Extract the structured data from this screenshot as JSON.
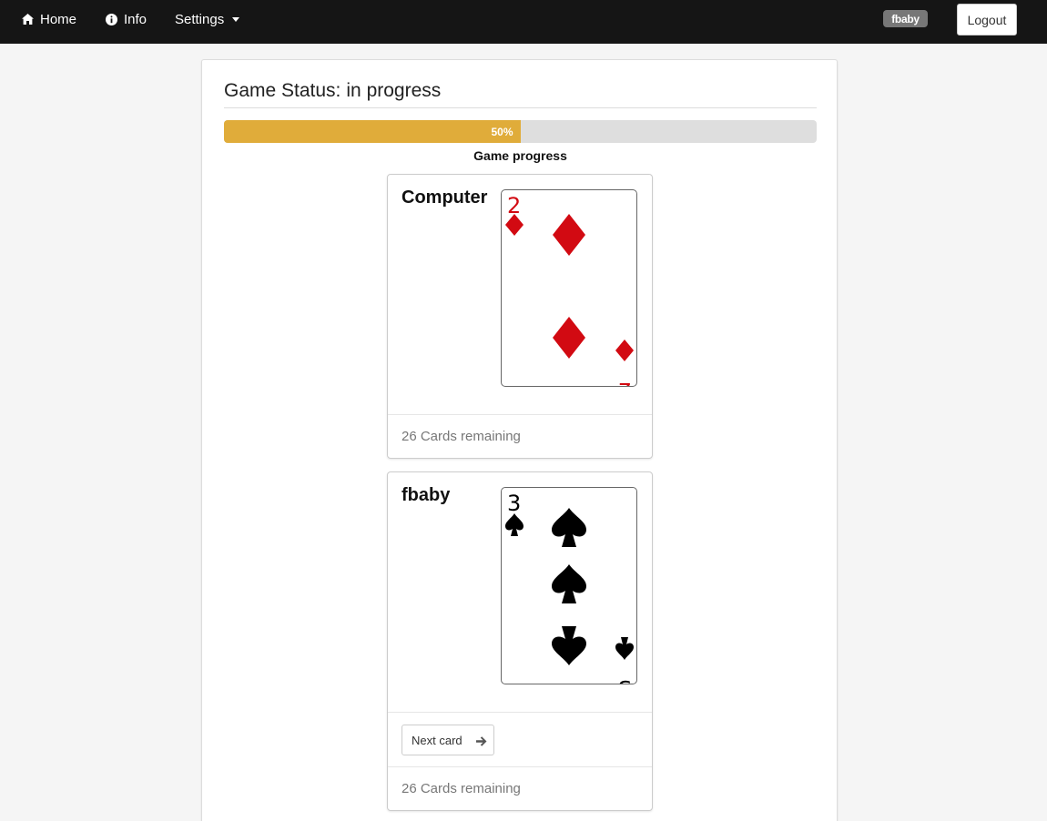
{
  "nav": {
    "home_label": "Home",
    "info_label": "Info",
    "settings_label": "Settings",
    "username": "fbaby",
    "logout_label": "Logout"
  },
  "game": {
    "status_label": "Game Status:",
    "status_value": "in progress",
    "progress_percent": 50,
    "progress_text": "50%",
    "progress_label": "Game progress",
    "progress_color": "#e0ac3a"
  },
  "computer": {
    "name": "Computer",
    "card": {
      "rank": "2",
      "suit": "diamonds",
      "color": "#d20a12"
    },
    "remaining": "26 Cards remaining"
  },
  "player": {
    "name": "fbaby",
    "card": {
      "rank": "3",
      "suit": "spades",
      "color": "#000000"
    },
    "next_button_label": "Next card",
    "remaining": "26 Cards remaining"
  },
  "icons": [
    "home-icon",
    "info-icon",
    "chevron-down-icon",
    "arrow-right-icon"
  ]
}
